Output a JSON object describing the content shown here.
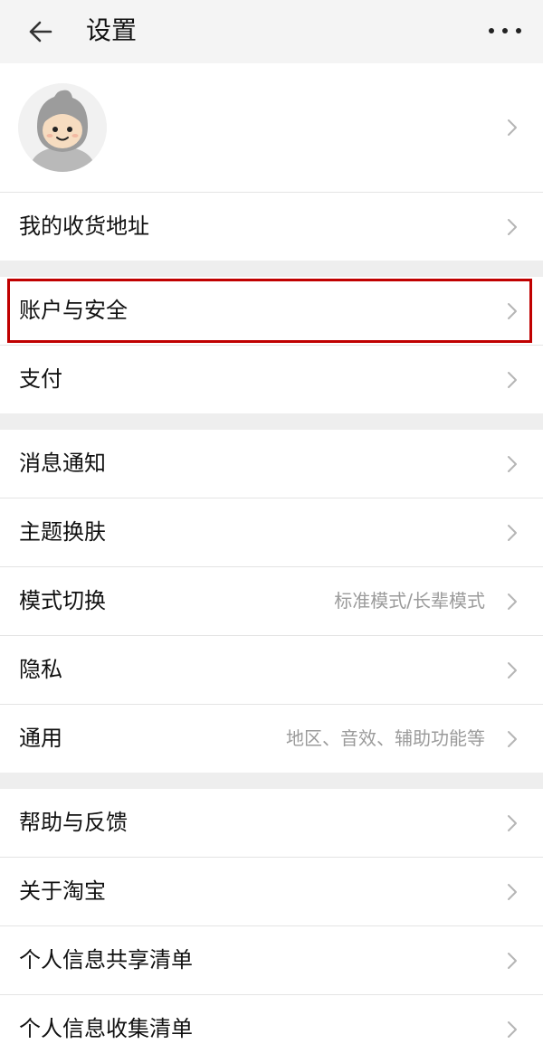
{
  "header": {
    "title": "设置"
  },
  "address": {
    "label": "我的收货地址"
  },
  "group_account": [
    {
      "label": "账户与安全"
    },
    {
      "label": "支付"
    }
  ],
  "group_prefs": [
    {
      "label": "消息通知",
      "hint": ""
    },
    {
      "label": "主题换肤",
      "hint": ""
    },
    {
      "label": "模式切换",
      "hint": "标准模式/长辈模式"
    },
    {
      "label": "隐私",
      "hint": ""
    },
    {
      "label": "通用",
      "hint": "地区、音效、辅助功能等"
    }
  ],
  "group_about": [
    {
      "label": "帮助与反馈"
    },
    {
      "label": "关于淘宝"
    },
    {
      "label": "个人信息共享清单"
    },
    {
      "label": "个人信息收集清单"
    }
  ],
  "colors": {
    "highlight": "#c00000",
    "background": "#f4f4f4"
  },
  "icons": {
    "back": "arrow-left-icon",
    "more": "more-horizontal-icon",
    "chevron": "chevron-right-icon"
  }
}
